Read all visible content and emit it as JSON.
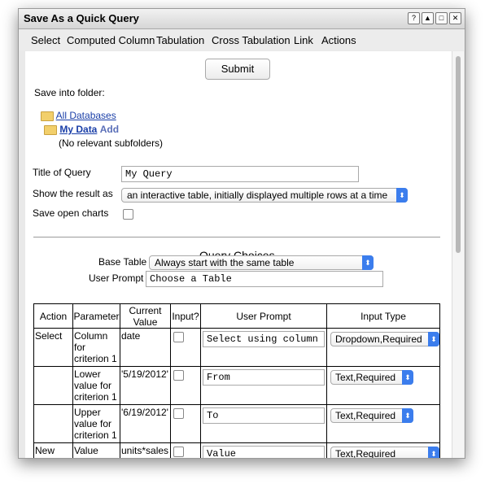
{
  "window": {
    "title": "Save As a Quick Query",
    "buttons": [
      "?",
      "▲",
      "□",
      "✕"
    ]
  },
  "menu": [
    "Select",
    "Computed Column",
    "Tabulation",
    "Cross Tabulation",
    "Link",
    "Actions"
  ],
  "submit_label": "Submit",
  "save_into_folder_label": "Save into folder:",
  "folders": {
    "all_databases": "All Databases",
    "my_data": "My Data",
    "add": "Add",
    "no_subfolders": "(No relevant subfolders)"
  },
  "form": {
    "title_label": "Title of Query",
    "title_value": "My Query",
    "show_result_label": "Show the result as",
    "show_result_value": "an interactive table, initially displayed multiple rows at a time",
    "save_charts_label": "Save open charts"
  },
  "query_choices": {
    "heading": "Query Choices",
    "base_table_label": "Base Table",
    "base_table_value": "Always start with the same table",
    "user_prompt_label": "User Prompt",
    "user_prompt_value": "Choose a Table"
  },
  "table": {
    "headers": [
      "Action",
      "Parameter",
      "Current Value",
      "Input?",
      "User Prompt",
      "Input Type"
    ],
    "rows": [
      {
        "action": "Select",
        "parameter": "Column for criterion 1",
        "current": "date",
        "prompt": "Select using column",
        "type": "Dropdown,Required"
      },
      {
        "action": "",
        "parameter": "Lower value for criterion 1",
        "current": "'5/19/2012'",
        "prompt": "From",
        "type": "Text,Required"
      },
      {
        "action": "",
        "parameter": "Upper value for criterion 1",
        "current": "'6/19/2012'",
        "prompt": "To",
        "type": "Text,Required"
      },
      {
        "action": "New Column",
        "parameter": "Value",
        "current": "units*sales",
        "prompt": "Value",
        "type": "Text,Required"
      }
    ]
  }
}
